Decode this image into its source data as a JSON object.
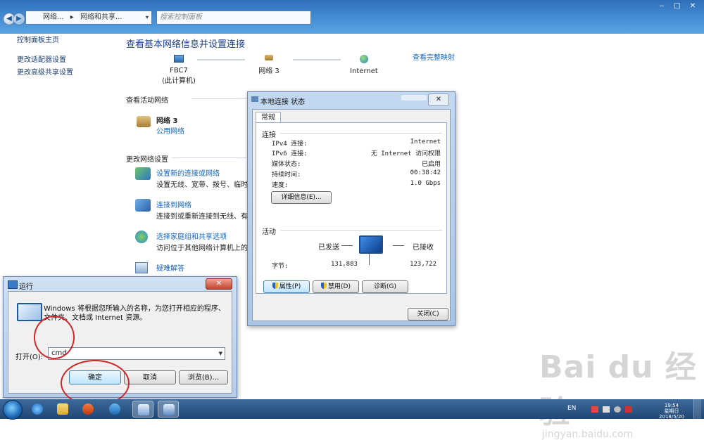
{
  "address_bar": {
    "crumbs": [
      "网络...",
      "网络和共享..."
    ],
    "search_placeholder": "搜索控制面板"
  },
  "left_panel": {
    "home": "控制面板主页",
    "links": [
      "更改适配器设置",
      "更改高级共享设置"
    ]
  },
  "main": {
    "title": "查看基本网络信息并设置连接",
    "full_map": "查看完整映射",
    "nodes": [
      {
        "name": "FBC7",
        "sub": "(此计算机)"
      },
      {
        "name": "网络  3",
        "sub": ""
      },
      {
        "name": "Internet",
        "sub": ""
      }
    ],
    "active_networks_header": "查看活动网络",
    "active_network": {
      "name": "网络  3",
      "type": "公用网络"
    },
    "change_settings_header": "更改网络设置",
    "tasks": [
      {
        "link": "设置新的连接或网络",
        "desc": "设置无线、宽带、拨号、临时或"
      },
      {
        "link": "连接到网络",
        "desc": "连接到或重新连接到无线、有线"
      },
      {
        "link": "选择家庭组和共享选项",
        "desc": "访问位于其他网络计算机上的文"
      },
      {
        "link": "疑难解答",
        "desc": ""
      }
    ]
  },
  "status_dialog": {
    "title": "本地连接 状态",
    "close_label": "✕",
    "tab": "常规",
    "connection_header": "连接",
    "rows": [
      {
        "label": "IPv4 连接:",
        "value": "Internet"
      },
      {
        "label": "IPv6 连接:",
        "value": "无 Internet 访问权限"
      },
      {
        "label": "媒体状态:",
        "value": "已启用"
      },
      {
        "label": "持续时间:",
        "value": "00:38:42"
      },
      {
        "label": "速度:",
        "value": "1.0 Gbps"
      }
    ],
    "details_button": "详细信息(E)...",
    "activity_header": "活动",
    "sent_label": "已发送",
    "received_label": "已接收",
    "bytes_label": "字节:",
    "bytes_sent": "131,883",
    "bytes_received": "123,722",
    "properties_button": "属性(P)",
    "disable_button": "禁用(D)",
    "diagnose_button": "诊断(G)",
    "close_button": "关闭(C)"
  },
  "run_dialog": {
    "title": "运行",
    "close_label": "✕",
    "description": "Windows 将根据您所输入的名称，为您打开相应的程序、文件夹、文档或 Internet 资源。",
    "open_label": "打开(O):",
    "input_value": "cmd",
    "ok_button": "确定",
    "cancel_button": "取消",
    "browse_button": "浏览(B)..."
  },
  "taskbar": {
    "language": "EN",
    "time": "19:54",
    "weekday": "星期日",
    "date": "2018/5/20"
  },
  "watermark": {
    "main": "Bai du 经验",
    "sub": "jingyan.baidu.com"
  },
  "colors": {
    "link": "#1565c0",
    "title_blue": "#1e3f8f",
    "highlight_ellipse": "#d0262a"
  }
}
